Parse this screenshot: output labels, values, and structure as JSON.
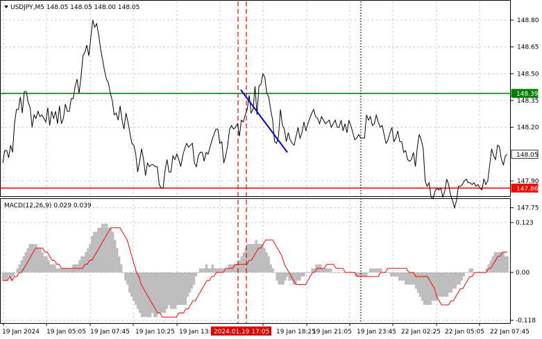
{
  "header": {
    "symbol_line": "USDJPY,M5  148.05 148.05 148.00 148.05",
    "macd_label": "MACD(12,26,9) 0.029 0.039"
  },
  "colors": {
    "background": "#ffffff",
    "grid": "#c8c8c8",
    "price_line": "#000000",
    "resistance": "#008000",
    "support": "#ff0000",
    "trend_segment": "#0000cc",
    "vertical_markers": "#e00000",
    "macd_hist": "#bdbdbd",
    "macd_signal": "#ff0000",
    "current_price_box": "#ffffff"
  },
  "chart_data": [
    {
      "type": "line",
      "title": "USDJPY,M5",
      "ylim": [
        147.7,
        148.88
      ],
      "y_ticks": [
        "148.80",
        "148.65",
        "148.50",
        "148.35",
        "148.20",
        "147.90",
        "147.75"
      ],
      "x_tick_labels": [
        "19 Jan 2024",
        "19 Jan 05:05",
        "19 Jan 07:45",
        "19 Jan 10:25",
        "19 Jan 13:05",
        "2024.01.19 17:05",
        "19 Jan 18:25",
        "19 Jan 21:05",
        "19 Jan 23:45",
        "22 Jan 02:25",
        "22 Jan 05:05",
        "22 Jan 07:45"
      ],
      "levels": [
        {
          "name": "resistance",
          "value": 148.39,
          "label": "148.39"
        },
        {
          "name": "support",
          "value": 147.86,
          "label": "147.86"
        },
        {
          "name": "current",
          "value": 148.05,
          "label": "148.05"
        }
      ],
      "trend_segment": {
        "from": 148.41,
        "to": 148.06
      },
      "series": [
        {
          "values": [
            148.0,
            148.07,
            148.07,
            148.03,
            148.1,
            148.06,
            148.22,
            148.3,
            148.3,
            148.37,
            148.28,
            148.4,
            148.4,
            148.34,
            148.31,
            148.2,
            148.27,
            148.25,
            148.29,
            148.26,
            148.27,
            148.25,
            148.23,
            148.31,
            148.21,
            148.29,
            148.25,
            148.29,
            148.22,
            148.32,
            148.22,
            148.25,
            148.33,
            148.29,
            148.29,
            148.36,
            148.36,
            148.43,
            148.47,
            148.39,
            148.48,
            148.6,
            148.62,
            148.66,
            148.6,
            148.7,
            148.8,
            148.76,
            148.78,
            148.72,
            148.64,
            148.58,
            148.52,
            148.47,
            148.45,
            148.39,
            148.35,
            148.27,
            148.28,
            148.24,
            148.32,
            148.24,
            148.19,
            148.28,
            148.23,
            148.17,
            148.11,
            148.1,
            148.05,
            147.95,
            148.01,
            148.08,
            148.02,
            147.93,
            148.0,
            147.98,
            147.99,
            147.99,
            147.98,
            147.98,
            147.88,
            147.86,
            147.86,
            147.96,
            148.02,
            147.95,
            147.95,
            148.04,
            148.02,
            148.05,
            148.02,
            147.98,
            148.04,
            148.08,
            148.11,
            148.09,
            148.1,
            148.11,
            148.0,
            147.98,
            148.04,
            148.06,
            148.06,
            148.01,
            148.06,
            148.05,
            148.09,
            148.13,
            148.16,
            148.19,
            148.19,
            148.11,
            148.12,
            148.0,
            148.04,
            148.1,
            148.19,
            148.21,
            148.19,
            148.2,
            148.22,
            148.15,
            148.24,
            148.23,
            148.27,
            148.3,
            148.38,
            148.28,
            148.3,
            148.43,
            148.27,
            148.43,
            148.44,
            148.5,
            148.48,
            148.39,
            148.37,
            148.3,
            148.24,
            148.12,
            148.11,
            148.15,
            148.3,
            148.21,
            148.19,
            148.12,
            148.17,
            148.13,
            148.11,
            148.1,
            148.15,
            148.2,
            148.14,
            148.17,
            148.23,
            148.18,
            148.22,
            148.25,
            148.28,
            148.3,
            148.26,
            148.25,
            148.22,
            148.26,
            148.24,
            148.22,
            148.23,
            148.24,
            148.2,
            148.22,
            148.24,
            148.2,
            148.2,
            148.24,
            148.18,
            148.22,
            148.17,
            148.24,
            148.21,
            148.17,
            148.13,
            148.14,
            148.16,
            148.14,
            148.14,
            148.14,
            148.27,
            148.24,
            148.26,
            148.21,
            148.22,
            148.27,
            148.23,
            148.2,
            148.21,
            148.16,
            148.11,
            148.13,
            148.17,
            148.2,
            148.12,
            148.14,
            148.18,
            148.12,
            148.12,
            148.06,
            148.07,
            148.02,
            148.01,
            148.02,
            148.06,
            147.98,
            148.09,
            148.16,
            148.13,
            148.08,
            147.9,
            147.87,
            147.89,
            147.81,
            147.8,
            147.84,
            147.86,
            147.85,
            147.86,
            147.81,
            147.84,
            147.91,
            147.88,
            147.82,
            147.79,
            147.75,
            147.79,
            147.87,
            147.87,
            147.88,
            147.9,
            147.91,
            147.89,
            147.89,
            147.88,
            147.89,
            147.87,
            147.88,
            147.86,
            147.85,
            147.91,
            147.88,
            147.9,
            147.99,
            148.08,
            148.04,
            148.02,
            148.1,
            148.09,
            148.02,
            147.99,
            148.04,
            148.05
          ]
        }
      ]
    },
    {
      "type": "bar",
      "title": "MACD(12,26,9)",
      "ylim": [
        -0.118,
        0.123
      ],
      "y_ticks": [
        "0.123",
        "0.00",
        "-0.118"
      ],
      "series": [
        {
          "name": "MACD",
          "values": [
            -0.02,
            -0.02,
            -0.02,
            -0.01,
            -0.02,
            -0.01,
            0.0,
            0.01,
            0.02,
            0.03,
            0.04,
            0.05,
            0.06,
            0.07,
            0.07,
            0.07,
            0.07,
            0.06,
            0.06,
            0.05,
            0.04,
            0.04,
            0.03,
            0.02,
            0.02,
            0.02,
            0.01,
            0.01,
            0.01,
            0.01,
            0.01,
            0.01,
            0.01,
            0.01,
            0.02,
            0.02,
            0.02,
            0.03,
            0.04,
            0.04,
            0.05,
            0.06,
            0.07,
            0.09,
            0.1,
            0.1,
            0.11,
            0.11,
            0.12,
            0.12,
            0.12,
            0.11,
            0.11,
            0.1,
            0.08,
            0.06,
            0.04,
            0.02,
            -0.0,
            -0.02,
            -0.03,
            -0.05,
            -0.06,
            -0.07,
            -0.08,
            -0.09,
            -0.1,
            -0.11,
            -0.11,
            -0.11,
            -0.11,
            -0.11,
            -0.1,
            -0.11,
            -0.11,
            -0.1,
            -0.1,
            -0.1,
            -0.1,
            -0.09,
            -0.08,
            -0.09,
            -0.09,
            -0.09,
            -0.08,
            -0.08,
            -0.08,
            -0.08,
            -0.08,
            -0.06,
            -0.05,
            -0.04,
            -0.03,
            -0.01,
            0.0,
            0.01,
            0.01,
            0.01,
            0.02,
            0.01,
            0.01,
            0.02,
            0.01,
            0.01,
            0.01,
            0.01,
            0.01,
            0.01,
            0.01,
            0.02,
            0.02,
            0.02,
            0.02,
            0.02,
            0.03,
            0.04,
            0.05,
            0.06,
            0.07,
            0.07,
            0.07,
            0.07,
            0.08,
            0.07,
            0.07,
            0.07,
            0.06,
            0.05,
            0.04,
            0.02,
            0.01,
            -0.0,
            -0.02,
            -0.03,
            -0.03,
            -0.03,
            -0.02,
            -0.01,
            -0.02,
            -0.02,
            -0.03,
            -0.03,
            -0.02,
            -0.02,
            -0.01,
            -0.01,
            -0.0,
            -0.0,
            0.0,
            0.01,
            0.01,
            0.02,
            0.02,
            0.02,
            0.01,
            0.01,
            0.01,
            0.01,
            0.01,
            0.0,
            0.0,
            0.0,
            0.0,
            0.0,
            -0.0,
            -0.0,
            -0.0,
            0.0,
            -0.0,
            -0.0,
            -0.01,
            -0.01,
            -0.01,
            -0.01,
            -0.01,
            -0.01,
            0.0,
            0.01,
            0.01,
            0.01,
            0.01,
            0.01,
            0.01,
            0.0,
            0.0,
            0.0,
            -0.0,
            -0.01,
            -0.01,
            -0.01,
            -0.01,
            -0.02,
            -0.02,
            -0.02,
            -0.03,
            -0.03,
            -0.03,
            -0.03,
            -0.03,
            -0.04,
            -0.05,
            -0.06,
            -0.07,
            -0.08,
            -0.08,
            -0.08,
            -0.08,
            -0.07,
            -0.07,
            -0.07,
            -0.06,
            -0.06,
            -0.06,
            -0.06,
            -0.06,
            -0.05,
            -0.05,
            -0.04,
            -0.04,
            -0.03,
            -0.03,
            -0.02,
            -0.01,
            -0.0,
            -0.0,
            0.01,
            0.01,
            0.0,
            0.0,
            0.0,
            0.0,
            0.0,
            0.0,
            0.01,
            0.02,
            0.03,
            0.04,
            0.05,
            0.05,
            0.05,
            0.05,
            0.05,
            0.04,
            0.04
          ]
        },
        {
          "name": "Signal",
          "values": [
            -0.02,
            -0.02,
            -0.02,
            -0.01,
            -0.02,
            -0.01,
            -0.01,
            -0.0,
            0.0,
            0.01,
            0.02,
            0.03,
            0.04,
            0.05,
            0.06,
            0.06,
            0.06,
            0.06,
            0.05,
            0.05,
            0.04,
            0.03,
            0.03,
            0.02,
            0.02,
            0.01,
            0.01,
            0.01,
            0.01,
            0.01,
            0.01,
            0.01,
            0.01,
            0.01,
            0.01,
            0.02,
            0.02,
            0.03,
            0.03,
            0.04,
            0.05,
            0.06,
            0.07,
            0.08,
            0.09,
            0.1,
            0.11,
            0.11,
            0.11,
            0.11,
            0.11,
            0.1,
            0.09,
            0.08,
            0.06,
            0.04,
            0.02,
            0.0,
            -0.01,
            -0.03,
            -0.04,
            -0.05,
            -0.06,
            -0.07,
            -0.08,
            -0.09,
            -0.1,
            -0.1,
            -0.11,
            -0.11,
            -0.11,
            -0.11,
            -0.11,
            -0.11,
            -0.11,
            -0.1,
            -0.1,
            -0.1,
            -0.09,
            -0.09,
            -0.08,
            -0.07,
            -0.07,
            -0.06,
            -0.05,
            -0.04,
            -0.03,
            -0.02,
            -0.02,
            -0.01,
            -0.01,
            -0.0,
            -0.0,
            0.0,
            0.0,
            0.01,
            0.01,
            0.01,
            0.01,
            0.02,
            0.02,
            0.02,
            0.02,
            0.02,
            0.02,
            0.03,
            0.03,
            0.04,
            0.05,
            0.06,
            0.06,
            0.07,
            0.08,
            0.08,
            0.08,
            0.08,
            0.07,
            0.06,
            0.05,
            0.04,
            0.02,
            0.01,
            -0.0,
            -0.01,
            -0.02,
            -0.03,
            -0.03,
            -0.03,
            -0.03,
            -0.03,
            -0.02,
            -0.01,
            -0.0,
            0.0,
            0.01,
            0.01,
            0.01,
            0.01,
            0.02,
            0.02,
            0.02,
            0.02,
            0.01,
            0.01,
            0.01,
            0.01,
            0.0,
            0.0,
            0.0,
            0.0,
            -0.0,
            -0.01,
            -0.01,
            -0.01,
            -0.01,
            -0.01,
            -0.01,
            -0.01,
            -0.01,
            -0.01,
            -0.01,
            -0.0,
            0.0,
            0.0,
            0.01,
            0.01,
            0.01,
            0.01,
            0.01,
            0.01,
            0.01,
            0.01,
            0.01,
            0.0,
            0.0,
            -0.0,
            -0.01,
            -0.01,
            -0.01,
            -0.01,
            -0.01,
            -0.01,
            -0.02,
            -0.03,
            -0.04,
            -0.06,
            -0.07,
            -0.08,
            -0.08,
            -0.08,
            -0.08,
            -0.07,
            -0.07,
            -0.06,
            -0.05,
            -0.04,
            -0.04,
            -0.03,
            -0.02,
            -0.01,
            -0.01,
            0.0,
            0.0,
            0.0,
            0.0,
            0.0,
            0.0,
            0.01,
            0.01,
            0.02,
            0.03,
            0.04,
            0.04,
            0.05,
            0.05,
            0.05
          ]
        }
      ]
    }
  ]
}
